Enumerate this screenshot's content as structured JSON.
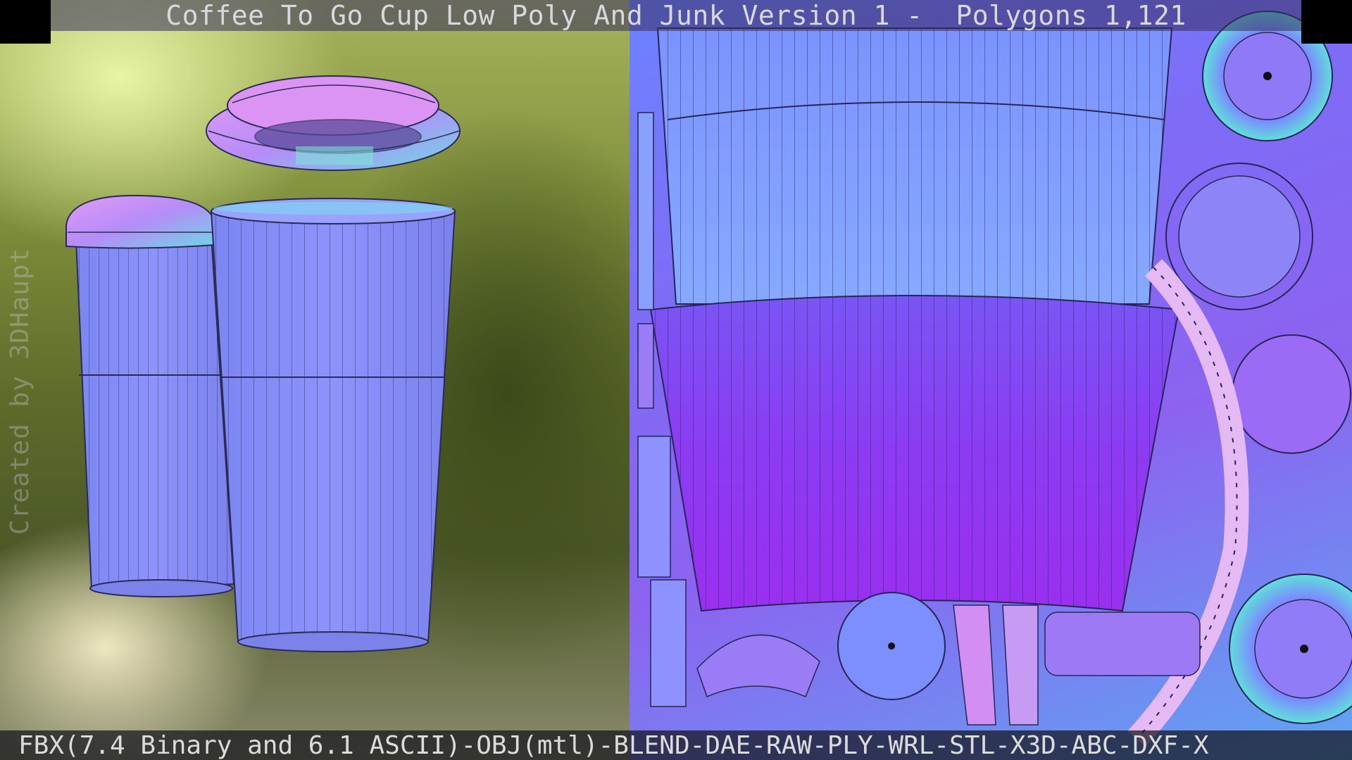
{
  "header": {
    "title": "Coffee To Go Cup Low Poly And Junk Version 1 -  Polygons 1,121"
  },
  "footer": {
    "formats": "FBX(7.4 Binary and 6.1 ASCII)-OBJ(mtl)-BLEND-DAE-RAW-PLY-WRL-STL-X3D-ABC-DXF-X"
  },
  "watermark": {
    "credit": "Created by 3DHaupt"
  },
  "colors": {
    "cup_body": "#8a8ef7",
    "lid": "#d889f2",
    "uv_purple": "#8c3bf2",
    "uv_blue": "#7a95ff"
  }
}
